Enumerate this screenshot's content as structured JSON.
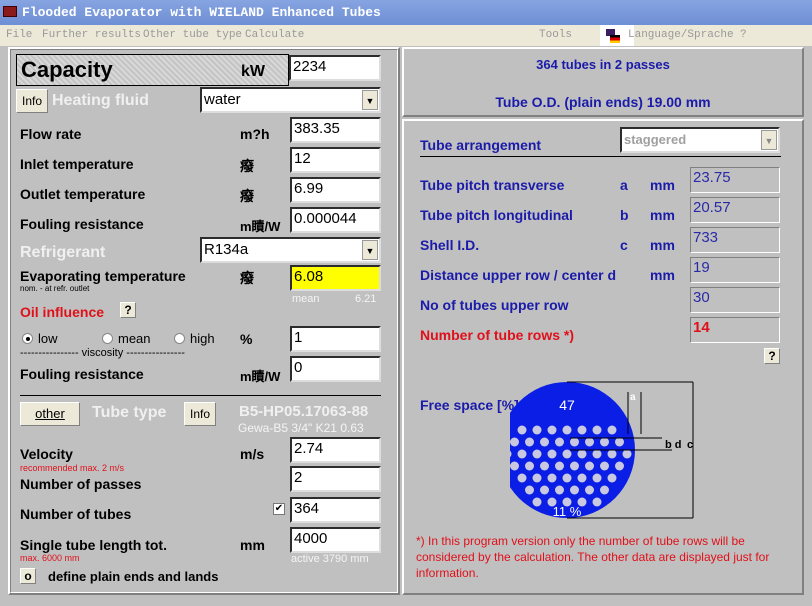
{
  "window": {
    "title": "Flooded Evaporator with WIELAND Enhanced Tubes"
  },
  "menu": {
    "file": "File",
    "further_results": "Further results",
    "other_tube_type": "Other tube type",
    "calculate": "Calculate",
    "tools": "Tools",
    "language": "Language/Sprache",
    "help": "?"
  },
  "left": {
    "capacity": {
      "label": "Capacity",
      "unit": "kW",
      "value": "2234"
    },
    "info_button": "Info",
    "heating_fluid": {
      "label": "Heating fluid",
      "selected": "water"
    },
    "flow_rate": {
      "label": "Flow rate",
      "unit": "m?h",
      "value": "383.35"
    },
    "inlet_temp": {
      "label": "Inlet temperature",
      "unit": "癈",
      "value": "12"
    },
    "outlet_temp": {
      "label": "Outlet temperature",
      "unit": "癈",
      "value": "6.99"
    },
    "fouling1": {
      "label": "Fouling resistance",
      "unit": "m瞔/W",
      "value": "0.000044"
    },
    "refrigerant": {
      "label": "Refrigerant",
      "selected": "R134a"
    },
    "evap_temp": {
      "label": "Evaporating temperature",
      "sub": "nom. - at refr. outlet",
      "unit": "癈",
      "value": "6.08",
      "mean_label": "mean",
      "mean_value": "6.21"
    },
    "oil": {
      "label": "Oil influence",
      "help": "?",
      "options": [
        "low",
        "mean",
        "high"
      ],
      "selected": "low",
      "unit": "%",
      "value": "1",
      "viscosity": "---------------- viscosity ----------------"
    },
    "fouling2": {
      "label": "Fouling resistance",
      "unit": "m瞔/W",
      "value": "0"
    },
    "tube_type": {
      "other_button": "other",
      "label": "Tube type",
      "info_button": "Info",
      "name": "B5-HP05.17063-88",
      "desc": "Gewa-B5  3/4\"  K21 0.63"
    },
    "velocity": {
      "label": "Velocity",
      "note": "recommended max. 2 m/s",
      "unit": "m/s",
      "value": "2.74"
    },
    "passes": {
      "label": "Number of passes",
      "value": "2"
    },
    "tubes": {
      "label": "Number of tubes",
      "checked": true,
      "value": "364"
    },
    "length": {
      "label": "Single tube length tot.",
      "note": "max. 6000 mm",
      "unit": "mm",
      "value": "4000",
      "active": "active 3790 mm"
    },
    "plain_ends": {
      "button": "o",
      "label": "define plain ends and lands"
    }
  },
  "right": {
    "summary1": "364 tubes in 2 passes",
    "summary2": "Tube O.D. (plain ends) 19.00 mm",
    "arrangement": {
      "label": "Tube arrangement",
      "selected": "staggered"
    },
    "rows": [
      {
        "label": "Tube pitch transverse",
        "sym": "a",
        "unit": "mm",
        "value": "23.75"
      },
      {
        "label": "Tube pitch longitudinal",
        "sym": "b",
        "unit": "mm",
        "value": "20.57"
      },
      {
        "label": "Shell I.D.",
        "sym": "c",
        "unit": "mm",
        "value": "733"
      },
      {
        "label": "Distance upper row / center d",
        "sym": "",
        "unit": "mm",
        "value": "19"
      },
      {
        "label": "No of tubes upper row",
        "sym": "",
        "unit": "",
        "value": "30"
      }
    ],
    "tube_rows": {
      "label": "Number of tube rows *)",
      "value": "14"
    },
    "help": "?",
    "free_space": {
      "label": "Free space [%]",
      "top": "47",
      "bottom": "11 %",
      "dim_a": "a",
      "dim_bd": "b d",
      "dim_c": "c"
    },
    "footnote": "*) In this program version only the number of tube rows will be considered by the calculation. The other data are displayed just for information."
  },
  "colors": {
    "accent_blue": "#1b1baa",
    "warn_red": "#e0101a",
    "highlight_yellow": "#ffff00",
    "diagram_blue": "#0a1ee6"
  }
}
